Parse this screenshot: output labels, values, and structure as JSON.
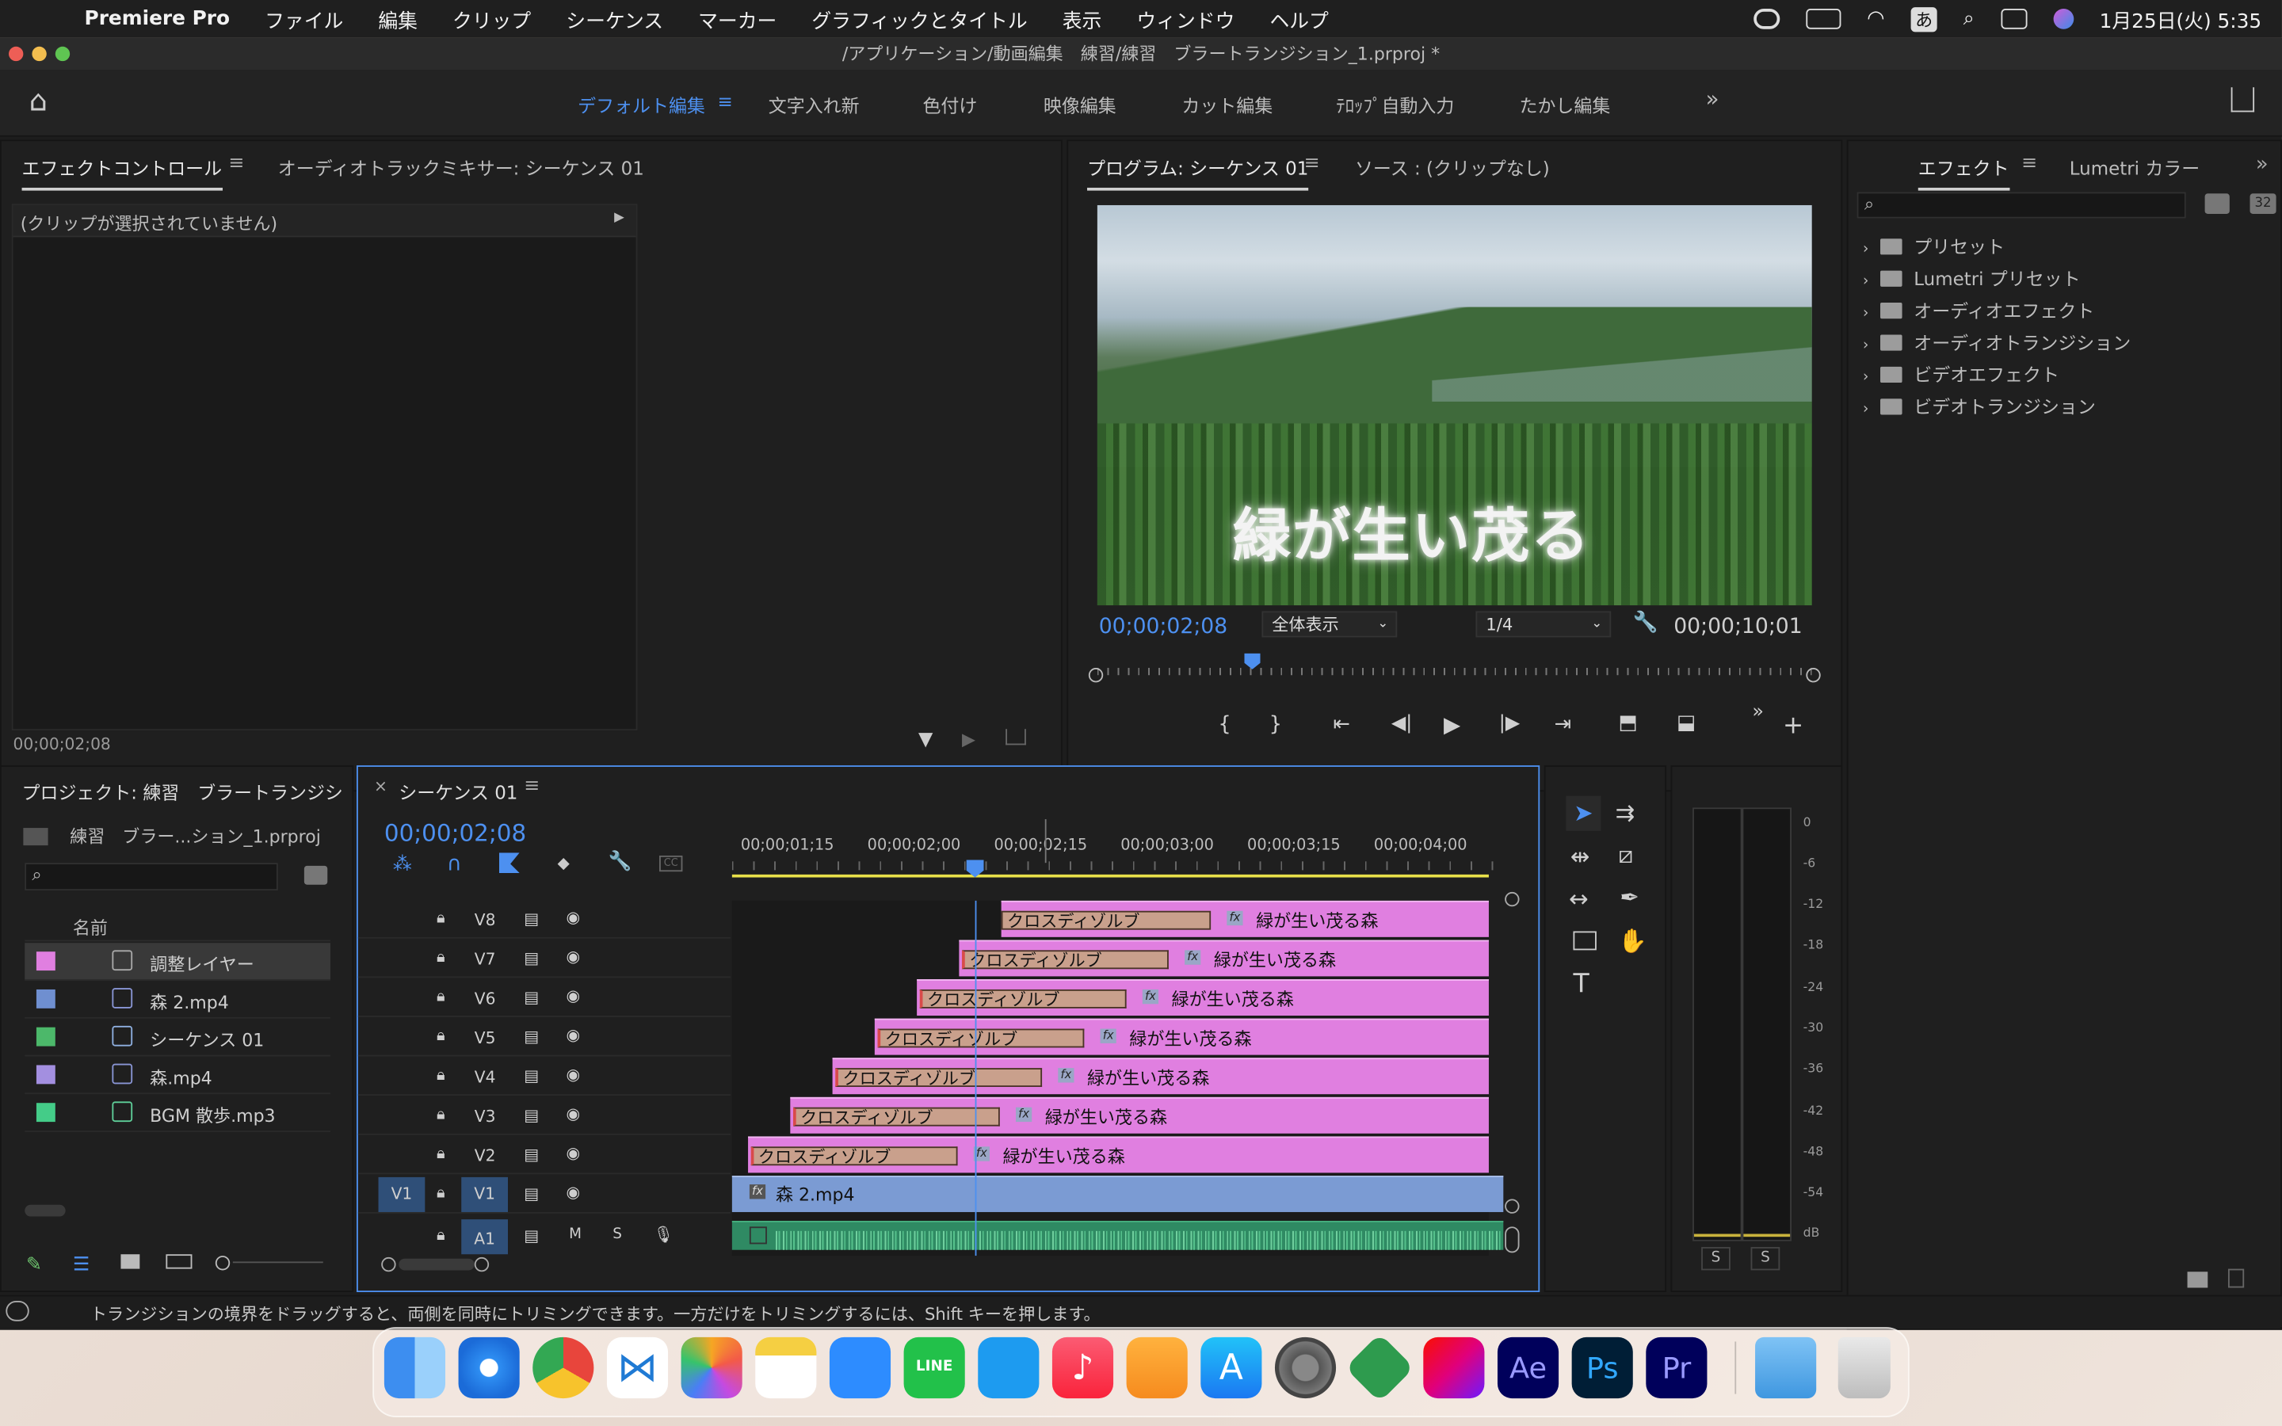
{
  "menubar": {
    "app": "Premiere Pro",
    "items": [
      "ファイル",
      "編集",
      "クリップ",
      "シーケンス",
      "マーカー",
      "グラフィックとタイトル",
      "表示",
      "ウィンドウ",
      "ヘルプ"
    ],
    "ime": "あ",
    "datetime": "1月25日(火) 5:35"
  },
  "window": {
    "title": "/アプリケーション/動画編集　練習/練習　ブラートランジション_1.prproj *"
  },
  "workspaces": [
    "デフォルト編集",
    "文字入れ新",
    "色付け",
    "映像編集",
    "カット編集",
    "ﾃﾛｯﾌﾟ自動入力",
    "たかし編集"
  ],
  "effect_controls": {
    "tab1": "エフェクトコントロール",
    "tab2": "オーディオトラックミキサー: シーケンス 01",
    "no_clip": "(クリップが選択されていません)",
    "timecode": "00;00;02;08"
  },
  "program": {
    "tab1": "プログラム: シーケンス 01",
    "tab2": "ソース : (クリップなし)",
    "caption": "緑が生い茂る",
    "timecode": "00;00;02;08",
    "fit": "全体表示",
    "quality": "1/4",
    "duration": "00;00;10;01"
  },
  "effects": {
    "tab1": "エフェクト",
    "tab2": "Lumetri カラー",
    "items": [
      "プリセット",
      "Lumetri プリセット",
      "オーディオエフェクト",
      "オーディオトランジション",
      "ビデオエフェクト",
      "ビデオトランジション"
    ]
  },
  "project": {
    "tab": "プロジェクト: 練習　ブラートランジシ",
    "path": "練習　ブラー...ション_1.prproj",
    "col_name": "名前",
    "items": [
      {
        "name": "調整レイヤー",
        "color": "#e07fe0"
      },
      {
        "name": "森 2.mp4",
        "color": "#6f8fd0"
      },
      {
        "name": "シーケンス 01",
        "color": "#4cb86a"
      },
      {
        "name": "森.mp4",
        "color": "#a38fe0"
      },
      {
        "name": "BGM 散歩.mp3",
        "color": "#44cc88"
      }
    ]
  },
  "timeline": {
    "tab": "シーケンス 01",
    "timecode": "00;00;02;08",
    "ruler": [
      "00;00;01;15",
      "00;00;02;00",
      "00;00;02;15",
      "00;00;03;00",
      "00;00;03;15",
      "00;00;04;00"
    ],
    "tracks": [
      "V8",
      "V7",
      "V6",
      "V5",
      "V4",
      "V3",
      "V2",
      "V1",
      "A1"
    ],
    "transition_label": "クロスディゾルブ",
    "clip_label": "緑が生い茂る森",
    "v1_clip": "森 2.mp4"
  },
  "meter": {
    "scale": [
      "0",
      "-6",
      "-12",
      "-18",
      "-24",
      "-30",
      "-36",
      "-42",
      "-48",
      "-54",
      "dB"
    ],
    "solo": "S"
  },
  "status": {
    "text": "トランジションの境界をドラッグすると、両側を同時にトリミングできます。一方だけをトリミングするには、Shift キーを押します。"
  },
  "dock": [
    "Finder",
    "Safari",
    "Chrome",
    "VS Code",
    "写真",
    "メモ",
    "Zoom",
    "LINE",
    "Twitter",
    "ミュージック",
    "Pages",
    "App Store",
    "システム環境設定",
    "Affinity",
    "Creative Cloud",
    "Ae",
    "Ps",
    "Pr",
    "ダウンロード",
    "ゴミ箱"
  ]
}
